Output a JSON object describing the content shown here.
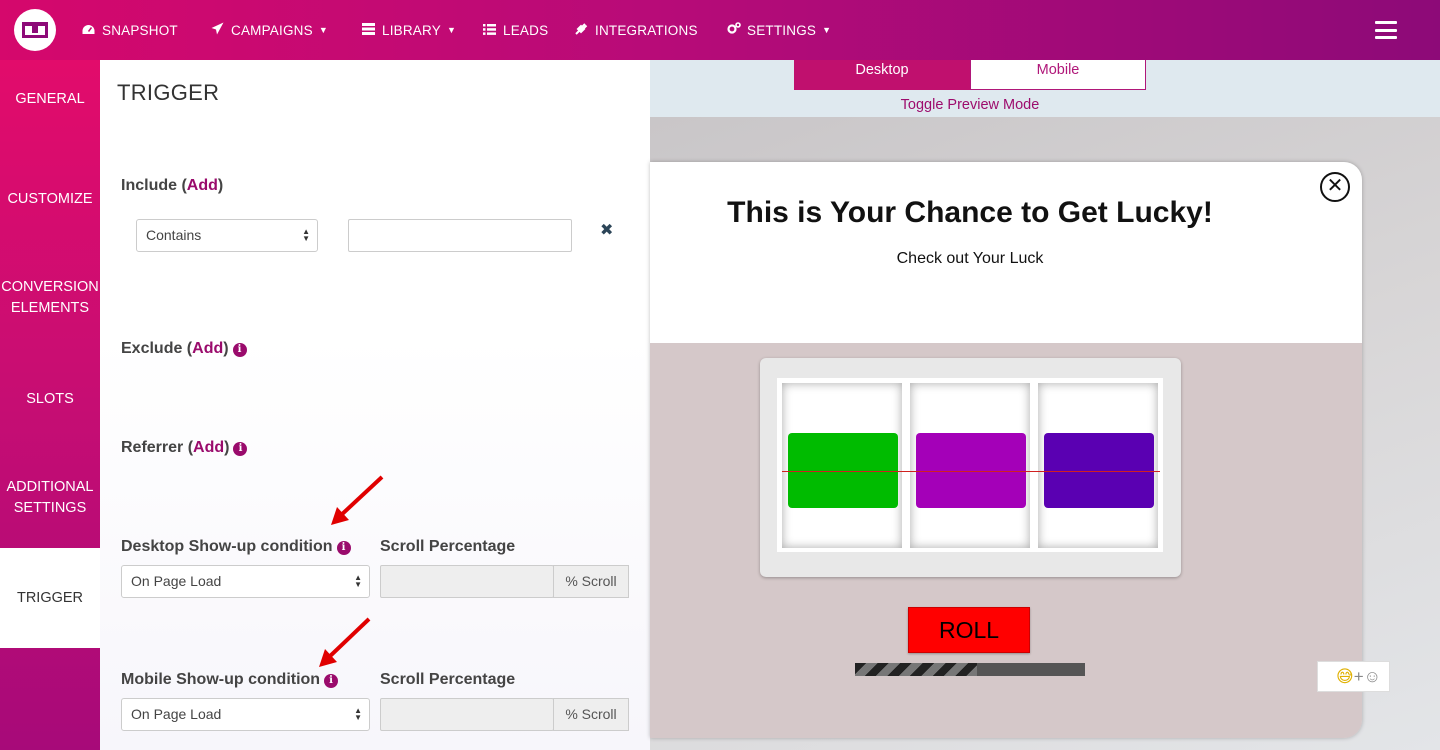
{
  "header": {
    "logo_icon": "logo-icon",
    "nav": [
      {
        "label": "SNAPSHOT",
        "icon": "dashboard-icon"
      },
      {
        "label": "CAMPAIGNS",
        "icon": "paper-plane-icon",
        "caret": true
      },
      {
        "label": "LIBRARY",
        "icon": "library-icon",
        "caret": true
      },
      {
        "label": "LEADS",
        "icon": "list-icon"
      },
      {
        "label": "INTEGRATIONS",
        "icon": "plug-icon"
      },
      {
        "label": "SETTINGS",
        "icon": "cogs-icon",
        "caret": true
      }
    ],
    "menu_icon": "hamburger-icon"
  },
  "sidebar": {
    "items": [
      {
        "label": "GENERAL"
      },
      {
        "label": "CUSTOMIZE"
      },
      {
        "label": "CONVERSION ELEMENTS"
      },
      {
        "label": "SLOTS"
      },
      {
        "label": "ADDITIONAL SETTINGS"
      },
      {
        "label": "TRIGGER",
        "active": true
      }
    ]
  },
  "panel": {
    "title": "TRIGGER",
    "include": {
      "label": "Include (",
      "add": "Add",
      "close": ")",
      "select_value": "Contains",
      "input_value": ""
    },
    "exclude": {
      "label": "Exclude (",
      "add": "Add",
      "close": ")"
    },
    "referrer": {
      "label": "Referrer (",
      "add": "Add",
      "close": ")"
    },
    "desktop": {
      "label": "Desktop Show-up condition",
      "select_value": "On Page Load",
      "scroll_label": "Scroll Percentage",
      "scroll_addon": "% Scroll",
      "scroll_value": ""
    },
    "mobile": {
      "label": "Mobile Show-up condition",
      "select_value": "On Page Load",
      "scroll_label": "Scroll Percentage",
      "scroll_addon": "% Scroll",
      "scroll_value": ""
    }
  },
  "preview": {
    "tabs": [
      {
        "label": "Desktop",
        "active": true
      },
      {
        "label": "Mobile"
      }
    ],
    "toggle_label": "Toggle Preview Mode",
    "popup": {
      "title": "This is Your Chance to Get Lucky!",
      "subtitle": "Check out Your Luck",
      "close_glyph": "✕",
      "reels": [
        {
          "color": "#00bb00"
        },
        {
          "color": "#a400b8"
        },
        {
          "color": "#5a00b2"
        }
      ],
      "roll_label": "ROLL",
      "progress": 0.53
    },
    "emoji_widget": {
      "emoji1": "😅",
      "plus": "+",
      "emoji2": "☺"
    }
  },
  "colors": {
    "brand": "#c0106e",
    "brand_dark": "#8d0a78",
    "accent_link": "#9a0b6c",
    "roll_button": "#ff0000",
    "annotation_arrow": "#e00000"
  }
}
